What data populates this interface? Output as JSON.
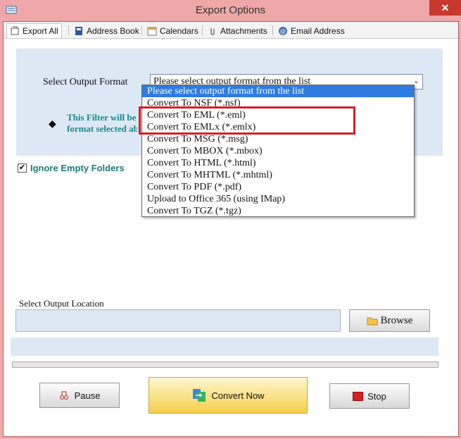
{
  "window": {
    "title": "Export Options",
    "close_label": "✕"
  },
  "tabs": [
    {
      "label": "Export All",
      "icon": "export-all-icon"
    },
    {
      "label": "Address Book",
      "icon": "address-book-icon"
    },
    {
      "label": "Calendars",
      "icon": "calendar-icon"
    },
    {
      "label": "Attachments",
      "icon": "attachment-icon"
    },
    {
      "label": "Email Address",
      "icon": "at-sign-icon"
    }
  ],
  "format": {
    "label": "Select Output Format",
    "selected": "Please select output format from the list",
    "options": [
      "Please select output format from the list",
      "Convert To NSF (*.nsf)",
      "Convert To EML (*.eml)",
      "Convert To EMLx (*.emlx)",
      "Convert To MSG (*.msg)",
      "Convert To MBOX (*.mbox)",
      "Convert To HTML (*.html)",
      "Convert To MHTML (*.mhtml)",
      "Convert To PDF (*.pdf)",
      "Upload to Office 365 (using IMap)",
      "Convert To TGZ (*.tgz)"
    ],
    "filter_note_line1": "This Filter will be u",
    "filter_note_line2": "format selected abo"
  },
  "options": {
    "ignore_empty_folders_label": "Ignore Empty Folders",
    "ignore_empty_folders_checked": "✔"
  },
  "location": {
    "label": "Select Output Location",
    "value": "",
    "browse_label": "Browse"
  },
  "progress": {
    "fraction": 0.0
  },
  "buttons": {
    "pause_label": "Pause",
    "convert_label": "Convert Now",
    "stop_label": "Stop"
  },
  "colors": {
    "titlebar": "#efa7a7",
    "close": "#c7392c",
    "panel": "#dde8f5",
    "highlight": "#d21f2a",
    "dropdown_selected": "#2f7be0",
    "note_text": "#1a8a8a"
  }
}
